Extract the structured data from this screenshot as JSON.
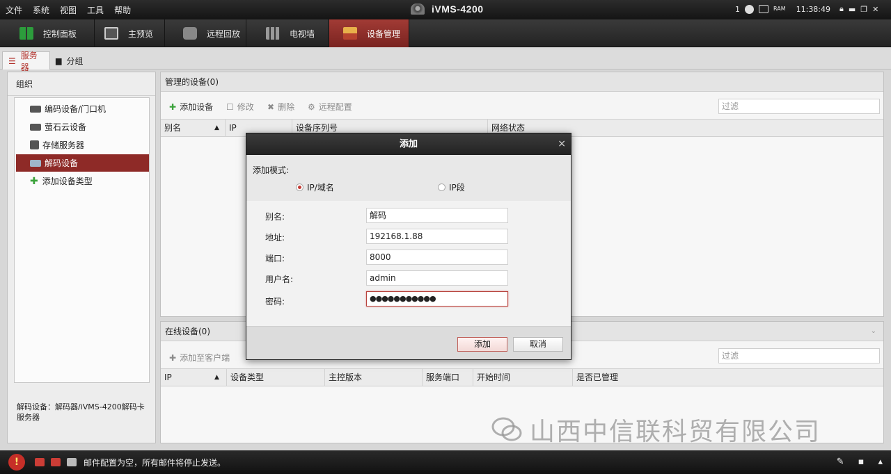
{
  "menubar": {
    "items": [
      "文件",
      "系统",
      "视图",
      "工具",
      "帮助"
    ]
  },
  "app": {
    "title": "iVMS-4200"
  },
  "system": {
    "alarm_count": "1",
    "ram_label": "RAM",
    "time": "11:38:49"
  },
  "tabs": [
    {
      "label": "控制面板",
      "icon": "control-panel-icon"
    },
    {
      "label": "主预览",
      "icon": "main-view-icon"
    },
    {
      "label": "远程回放",
      "icon": "remote-playback-icon"
    },
    {
      "label": "电视墙",
      "icon": "video-wall-icon"
    },
    {
      "label": "设备管理",
      "icon": "device-management-icon",
      "active": true
    }
  ],
  "subtabs": [
    {
      "label": "服务器",
      "active": true
    },
    {
      "label": "分组"
    }
  ],
  "leftpanel": {
    "title": "组织",
    "items": [
      {
        "label": "编码设备/门口机"
      },
      {
        "label": "萤石云设备"
      },
      {
        "label": "存储服务器"
      },
      {
        "label": "解码设备",
        "selected": true
      },
      {
        "label": "添加设备类型"
      }
    ],
    "description": "解码设备：解码器/iVMS-4200解码卡服务器"
  },
  "managed": {
    "title": "管理的设备(0)",
    "toolbar": {
      "add": "添加设备",
      "modify": "修改",
      "delete": "删除",
      "remote_config": "远程配置"
    },
    "filter_placeholder": "过滤",
    "columns": [
      "别名",
      "IP",
      "设备序列号",
      "网络状态"
    ]
  },
  "online": {
    "title": "在线设备(0)",
    "toolbar": {
      "add_to_client": "添加至客户端"
    },
    "filter_placeholder": "过滤",
    "columns": [
      "IP",
      "设备类型",
      "主控版本",
      "服务端口",
      "开始时间",
      "是否已管理"
    ]
  },
  "dialog": {
    "title": "添加",
    "close": "×",
    "mode_label": "添加模式:",
    "mode_options": [
      {
        "label": "IP/域名",
        "selected": true
      },
      {
        "label": "IP段",
        "selected": false
      }
    ],
    "fields": {
      "alias": {
        "label": "别名:",
        "value": "解码"
      },
      "address": {
        "label": "地址:",
        "value": "192168.1.88"
      },
      "port": {
        "label": "端口:",
        "value": "8000"
      },
      "username": {
        "label": "用户名:",
        "value": "admin"
      },
      "password": {
        "label": "密码:",
        "value": "●●●●●●●●●●●"
      }
    },
    "ok_label": "添加",
    "cancel_label": "取消"
  },
  "watermark": {
    "text": "山西中信联科贸有限公司"
  },
  "statusbar": {
    "message": "邮件配置为空，所有邮件将停止发送。",
    "warning_glyph": "!"
  },
  "colors": {
    "accent": "#8e2a27",
    "titlebar": "#1c1c1c"
  }
}
